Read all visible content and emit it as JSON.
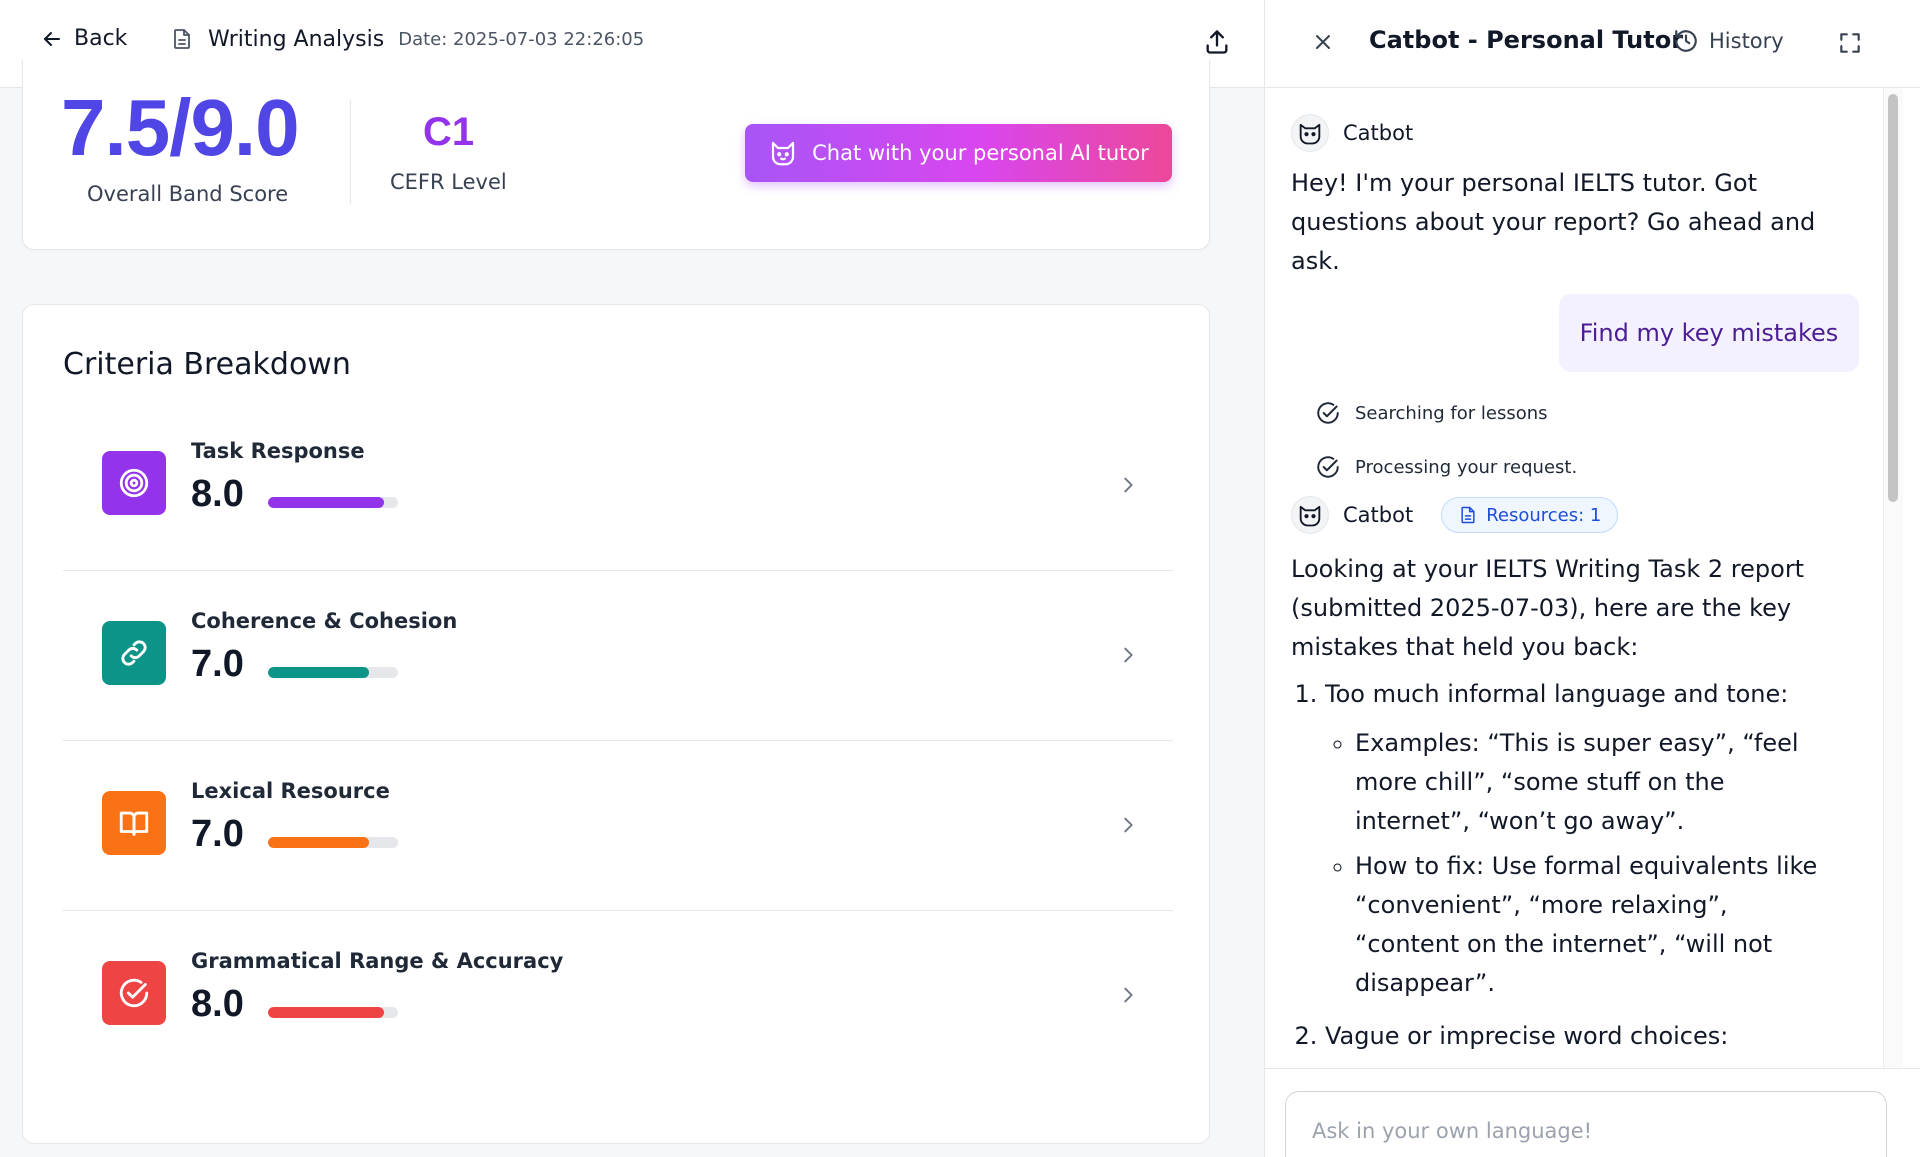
{
  "header": {
    "back_label": "Back",
    "doc_title": "Writing Analysis",
    "date": "Date: 2025-07-03 22:26:05"
  },
  "score": {
    "band": "7.5/9.0",
    "band_label": "Overall Band Score",
    "cefr": "C1",
    "cefr_label": "CEFR Level",
    "chat_button": "Chat with your personal AI tutor"
  },
  "criteria": {
    "title": "Criteria Breakdown",
    "items": [
      {
        "name": "Task Response",
        "score": "8.0",
        "fraction": 0.89,
        "color": "#9333ea",
        "icon": "target-icon"
      },
      {
        "name": "Coherence & Cohesion",
        "score": "7.0",
        "fraction": 0.78,
        "color": "#0d9488",
        "icon": "link-icon"
      },
      {
        "name": "Lexical Resource",
        "score": "7.0",
        "fraction": 0.78,
        "color": "#f97316",
        "icon": "book-icon"
      },
      {
        "name": "Grammatical Range & Accuracy",
        "score": "8.0",
        "fraction": 0.89,
        "color": "#ef4444",
        "icon": "check-circle-icon"
      }
    ]
  },
  "chat": {
    "title": "Catbot - Personal Tutor",
    "history_label": "History",
    "bot_name": "Catbot",
    "greeting": "Hey! I'm your personal IELTS tutor. Got questions about your report? Go ahead and ask.",
    "user_message": "Find my key mistakes",
    "steps": [
      "Searching for lessons",
      "Processing your request."
    ],
    "resources_label": "Resources: 1",
    "answer_intro": "Looking at your IELTS Writing Task 2 report (submitted 2025-07-03), here are the key mistakes that held you back:",
    "answer_points": [
      {
        "title": "Too much informal language and tone:",
        "bullets": [
          "Examples: “This is super easy”, “feel more chill”, “some stuff on the internet”, “won’t go away”.",
          "How to fix: Use formal equivalents like “convenient”, “more relaxing”, “content on the internet”, “will not disappear”."
        ]
      },
      {
        "title": "Vague or imprecise word choices:",
        "bullets": []
      }
    ],
    "input_placeholder": "Ask in your own language!"
  },
  "colors": {
    "primary": "#4f46e5",
    "cefr": "#9333ea",
    "chat_gradient_start": "#a855f7",
    "chat_gradient_end": "#ec4899"
  }
}
